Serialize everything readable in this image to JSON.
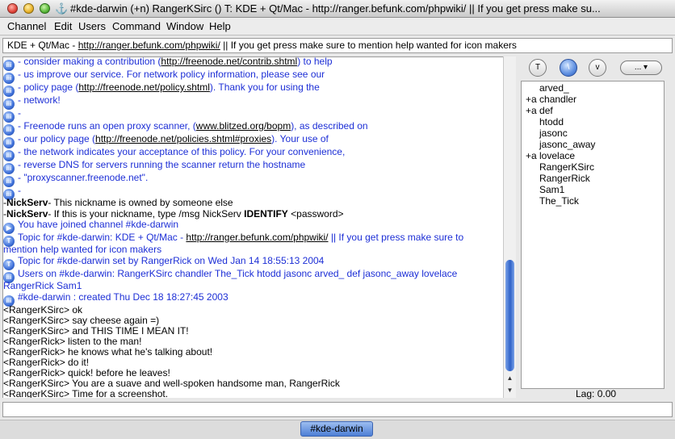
{
  "window": {
    "title": "#kde-darwin (+n) RangerKSirc () T: KDE + Qt/Mac - http://ranger.befunk.com/phpwiki/ || If you get press make su..."
  },
  "menu": [
    "Channel",
    "Edit",
    "Users",
    "Command",
    "Window",
    "Help"
  ],
  "topic": {
    "prefix": "KDE + Qt/Mac - ",
    "url": "http://ranger.befunk.com/phpwiki/",
    "suffix": " || If you get press make sure to mention help wanted for icon makers"
  },
  "chat": {
    "l1": {
      "a": "- consider making a contribution (",
      "u": "http://freenode.net/contrib.shtml",
      "b": ") to help"
    },
    "l2": "- us improve our service.  For network policy information, please see our",
    "l3": {
      "a": "- policy page (",
      "u": "http://freenode.net/policy.shtml",
      "b": "). Thank you for using the"
    },
    "l4": "- network!",
    "l5": "-",
    "l6": {
      "a": "- Freenode runs an open proxy scanner, (",
      "u": "www.blitzed.org/bopm",
      "b": "), as described on"
    },
    "l7": {
      "a": "- our policy page (",
      "u": "http://freenode.net/policies.shtml#proxies",
      "b": ").  Your use of"
    },
    "l8": "- the network indicates your acceptance of this policy.  For your convenience,",
    "l9": "- reverse DNS for servers running the scanner return the hostname",
    "l10": "- \"proxyscanner.freenode.net\".",
    "l11": "-",
    "l12": {
      "a": "-",
      "b": "NickServ",
      "c": "- This nickname is owned by someone else"
    },
    "l13": {
      "a": "-",
      "b": "NickServ",
      "c": "- If this is your nickname, type /msg NickServ ",
      "d": "IDENTIFY",
      "e": " <password>"
    },
    "l14": "You have joined channel #kde-darwin",
    "l15": {
      "a": "Topic for #kde-darwin: KDE + Qt/Mac - ",
      "u": "http://ranger.befunk.com/phpwiki/",
      "b": " || If you get press make sure to"
    },
    "l16": "mention help wanted for icon makers",
    "l17": "Topic for #kde-darwin set by RangerRick on Wed Jan  14 18:55:13 2004",
    "l18": "Users on #kde-darwin: RangerKSirc chandler The_Tick htodd jasonc arved_ def jasonc_away lovelace",
    "l19": "RangerRick Sam1",
    "l20": "#kde-darwin : created Thu Dec  18 18:27:45 2003",
    "l21": "<RangerKSirc> ok",
    "l22": "<RangerKSirc> say cheese again  =)",
    "l23": "<RangerKSirc> and THIS TIME I MEAN IT!",
    "l24": "<RangerRick> listen to the man!",
    "l25": "<RangerRick> he knows what he's talking about!",
    "l26": "<RangerRick> do it!",
    "l27": "<RangerRick> quick!  before he leaves!",
    "l28": "<RangerKSirc> You are a suave and well-spoken handsome man, RangerRick",
    "l29": "<RangerKSirc> Time for a screenshot."
  },
  "icons": {
    "motd": "iii",
    "topic": "T",
    "join": "▶"
  },
  "userlist_buttons": {
    "b1": "T",
    "b2": "\\",
    "b3": "v",
    "more": "... ▾"
  },
  "users": [
    "arved_",
    "+a chandler",
    "+a def",
    "htodd",
    "jasonc",
    "jasonc_away",
    "+a lovelace",
    "RangerKSirc",
    "RangerRick",
    "Sam1",
    "The_Tick"
  ],
  "lag": "Lag: 0.00",
  "tab": "#kde-darwin",
  "colors": {
    "info": "#1d2fd6",
    "accent": "#4d7fd6"
  }
}
